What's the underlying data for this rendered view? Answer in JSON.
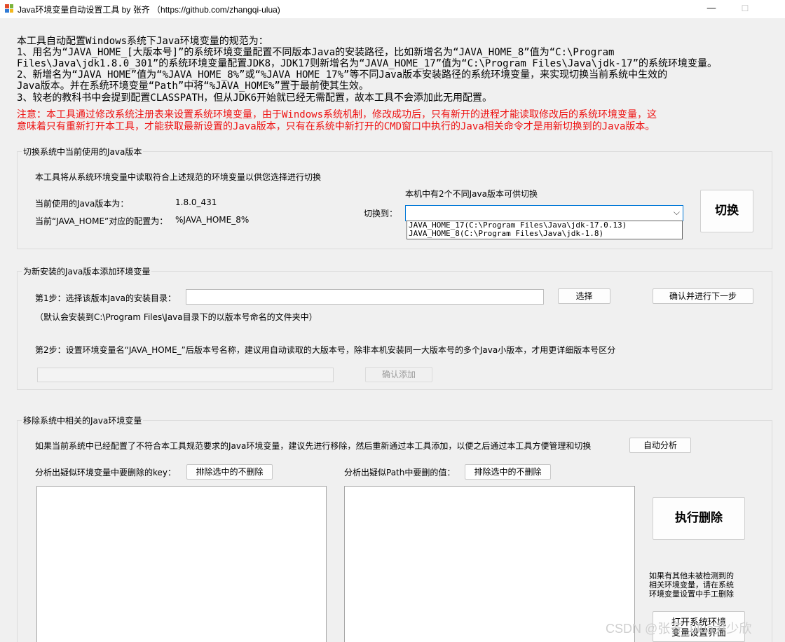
{
  "window": {
    "title": "Java环境变量自动设置工具 by 张齐 （https://github.com/zhangqi-ulua)",
    "minimize_glyph": "—",
    "maximize_glyph": "☐"
  },
  "intro": {
    "line1": "本工具自动配置Windows系统下Java环境变量的规范为：",
    "line2": "1、用名为“JAVA_HOME_[大版本号]”的系统环境变量配置不同版本Java的安装路径，比如新增名为“JAVA_HOME_8”值为“C:\\Program",
    "line3": "Files\\Java\\jdk1.8.0_301”的系统环境变量配置JDK8，JDK17则新增名为“JAVA_HOME_17”值为“C:\\Program Files\\Java\\jdk-17”的系统环境变量。",
    "line4": "2、新增名为“JAVA_HOME”值为“%JAVA_HOME_8%”或“%JAVA_HOME_17%”等不同Java版本安装路径的系统环境变量，来实现切换当前系统中生效的",
    "line5": "Java版本。并在系统环境变量“Path”中将“%JAVA_HOME%”置于最前使其生效。",
    "line6": "3、较老的教科书中会提到配置CLASSPATH，但从JDK6开始就已经无需配置，故本工具不会添加此无用配置。",
    "warn1": "注意：本工具通过修改系统注册表来设置系统环境变量，由于Windows系统机制，修改成功后，只有新开的进程才能读取修改后的系统环境变量，这",
    "warn2": "意味着只有重新打开本工具，才能获取最新设置的Java版本，只有在系统中新打开的CMD窗口中执行的Java相关命令才是用新切换到的Java版本。"
  },
  "switch_group": {
    "title": "切换系统中当前使用的Java版本",
    "desc": "本工具将从系统环境变量中读取符合上述规范的环境变量以供您选择进行切换",
    "current_version_label": "当前使用的Java版本为：",
    "current_version_value": "1.8.0_431",
    "java_home_label": "当前“JAVA_HOME”对应的配置为：",
    "java_home_value": "%JAVA_HOME_8%",
    "available_text": "本机中有2个不同Java版本可供切换",
    "switch_to_label": "切换到：",
    "selected_value": "",
    "options": [
      "JAVA_HOME_17(C:\\Program Files\\Java\\jdk-17.0.13)",
      "JAVA_HOME_8(C:\\Program Files\\Java\\jdk-1.8)"
    ],
    "switch_button": "切换"
  },
  "add_group": {
    "title": "为新安装的Java版本添加环境变量",
    "step1_label": "第1步：选择该版本Java的安装目录：",
    "path_value": "",
    "select_button": "选择",
    "confirm_next_button": "确认并进行下一步",
    "default_hint": "（默认会安装到C:\\Program Files\\Java目录下的以版本号命名的文件夹中）",
    "step2_label": "第2步：设置环境变量名“JAVA_HOME_”后版本号名称，建议用自动读取的大版本号，除非本机安装同一大版本号的多个Java小版本，才用更详细版本号区分",
    "version_value": "",
    "confirm_add_button": "确认添加"
  },
  "remove_group": {
    "title": "移除系统中相关的Java环境变量",
    "desc": "如果当前系统中已经配置了不符合本工具规范要求的Java环境变量，建议先进行移除，然后重新通过本工具添加，以便之后通过本工具方便管理和切换",
    "auto_analyze_button": "自动分析",
    "keys_label": "分析出疑似环境变量中要删除的key：",
    "exclude_keys_button": "排除选中的不删除",
    "path_label": "分析出疑似Path中要删的值：",
    "exclude_path_button": "排除选中的不删除",
    "execute_button": "执行删除",
    "manual_note_1": "如果有其他未被检测到的",
    "manual_note_2": "相关环境变量，请在系统",
    "manual_note_3": "环境变量设置中手工删除",
    "open_settings_1": "打开系统环境",
    "open_settings_2": "变量设置界面"
  },
  "watermark": "CSDN @张齐_ulua尹少欣"
}
